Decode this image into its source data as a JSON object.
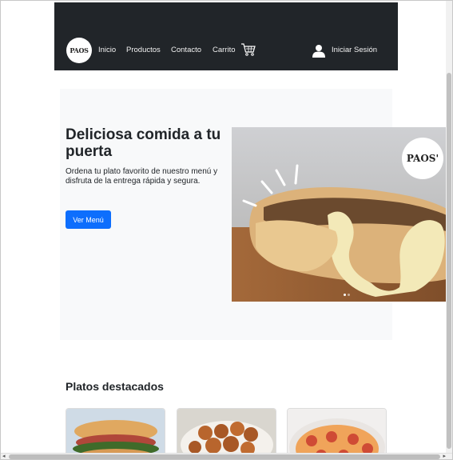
{
  "nav": {
    "logo_text": "PAOS",
    "links": [
      "Inicio",
      "Productos",
      "Contacto",
      "Carrito"
    ],
    "login": "Iniciar Sesión"
  },
  "hero": {
    "title": "Deliciosa comida a tu puerta",
    "description": "Ordena tu plato favorito de nuestro menú y disfruta de la entrega rápida y segura.",
    "button": "Ver Menú",
    "carousel_logo": "PAOS'"
  },
  "featured": {
    "title": "Platos destacados"
  },
  "colors": {
    "navbar": "#212529",
    "primary": "#0d6efd",
    "hero_bg": "#f8f9fa"
  }
}
